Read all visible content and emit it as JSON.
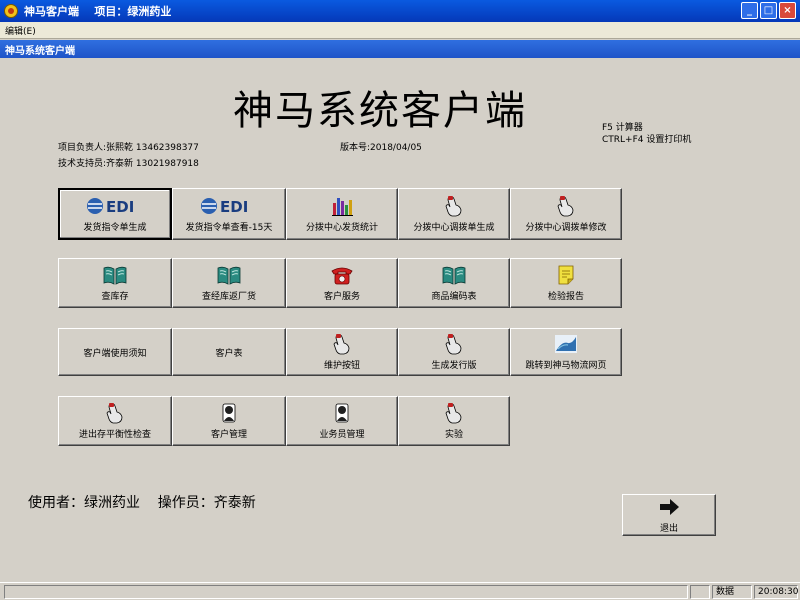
{
  "window": {
    "title": "神马客户端    项目：绿洲药业"
  },
  "menu": {
    "edit": "编辑(E)"
  },
  "child_window": {
    "title": "神马系统客户端"
  },
  "header": {
    "title": "神马系统客户端",
    "project_lead": "项目负责人:张熙乾 13462398377",
    "tech_support": "技术支持员:齐泰新 13021987918",
    "version": "版本号:2018/04/05",
    "hotkey_calc": "F5 计算器",
    "hotkey_printer": "CTRL+F4 设置打印机"
  },
  "buttons": {
    "r1": [
      {
        "label": "发货指令单生成",
        "icon": "edi-logo",
        "icon_text": "EDI"
      },
      {
        "label": "发货指令单查看-15天",
        "icon": "edi-logo",
        "icon_text": "EDI"
      },
      {
        "label": "分拨中心发货统计",
        "icon": "bar-chart-icon"
      },
      {
        "label": "分拨中心调拨单生成",
        "icon": "pointing-hand-icon"
      },
      {
        "label": "分拨中心调拨单修改",
        "icon": "pointing-hand-icon"
      }
    ],
    "r2": [
      {
        "label": "查库存",
        "icon": "book-icon"
      },
      {
        "label": "查经库返厂货",
        "icon": "book-icon"
      },
      {
        "label": "客户服务",
        "icon": "telephone-icon"
      },
      {
        "label": "商品编码表",
        "icon": "book-icon"
      },
      {
        "label": "检验报告",
        "icon": "note-icon"
      }
    ],
    "r3": [
      {
        "label": "客户端使用须知"
      },
      {
        "label": "客户表"
      },
      {
        "label": "维护按钮",
        "icon": "pointing-hand-icon"
      },
      {
        "label": "生成发行版",
        "icon": "pointing-hand-icon"
      },
      {
        "label": "跳转到神马物流网页",
        "icon": "web-logo-icon"
      }
    ],
    "r4": [
      {
        "label": "进出存平衡性检查",
        "icon": "pointing-hand-icon"
      },
      {
        "label": "客户管理",
        "icon": "person-icon"
      },
      {
        "label": "业务员管理",
        "icon": "person-icon"
      },
      {
        "label": "实验",
        "icon": "pointing-hand-icon"
      }
    ],
    "exit": {
      "label": "退出",
      "icon": "arrow-right-icon"
    }
  },
  "footer": {
    "user_line": "使用者：绿洲药业    操作员：齐泰新"
  },
  "status": {
    "cell1": "",
    "cell2": "",
    "caps": "数据",
    "time": "20:08:30"
  }
}
